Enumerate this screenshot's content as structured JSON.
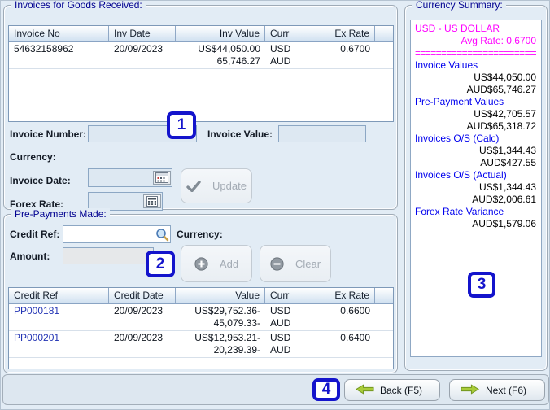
{
  "invoices": {
    "title": "Invoices for Goods Received:",
    "table": {
      "columns": [
        "Invoice No",
        "Inv Date",
        "Inv Value",
        "Curr",
        "Ex Rate"
      ],
      "rows": [
        {
          "invoice_no": "54632158962",
          "inv_date": "20/09/2023",
          "value_line1": "US$44,050.00",
          "value_line2": "65,746.27",
          "curr_line1": "USD",
          "curr_line2": "AUD",
          "ex_rate": "0.6700"
        }
      ]
    },
    "form": {
      "invoice_number_label": "Invoice Number:",
      "invoice_number_value": "",
      "invoice_value_label": "Invoice Value:",
      "invoice_value_value": "",
      "currency_label": "Currency:",
      "invoice_date_label": "Invoice Date:",
      "invoice_date_value": "",
      "forex_rate_label": "Forex Rate:",
      "forex_rate_value": "",
      "update_button_label": "Update"
    }
  },
  "prepayments": {
    "title": "Pre-Payments Made:",
    "form": {
      "credit_ref_label": "Credit Ref:",
      "credit_ref_value": "",
      "currency_label": "Currency:",
      "amount_label": "Amount:",
      "amount_value": "",
      "add_button_label": "Add",
      "clear_button_label": "Clear"
    },
    "table": {
      "columns": [
        "Credit Ref",
        "Credit Date",
        "Value",
        "Curr",
        "Ex Rate"
      ],
      "rows": [
        {
          "credit_ref": "PP000181",
          "credit_date": "20/09/2023",
          "value_line1": "US$29,752.36-",
          "value_line2": "45,079.33-",
          "curr_line1": "USD",
          "curr_line2": "AUD",
          "ex_rate": "0.6600"
        },
        {
          "credit_ref": "PP000201",
          "credit_date": "20/09/2023",
          "value_line1": "US$12,953.21-",
          "value_line2": "20,239.39-",
          "curr_line1": "USD",
          "curr_line2": "AUD",
          "ex_rate": "0.6400"
        }
      ]
    }
  },
  "summary": {
    "title": "Currency Summary:",
    "currency_line": "USD - US DOLLAR",
    "avg_rate_line": "Avg Rate: 0.6700",
    "separator": "=========================",
    "groups": [
      {
        "label": "Invoice Values",
        "values": [
          "US$44,050.00",
          "AUD$65,746.27"
        ]
      },
      {
        "label": "Pre-Payment Values",
        "values": [
          "US$42,705.57",
          "AUD$65,318.72"
        ]
      },
      {
        "label": "Invoices O/S (Calc)",
        "values": [
          "US$1,344.43",
          "AUD$427.55"
        ]
      },
      {
        "label": "Invoices O/S (Actual)",
        "values": [
          "US$1,344.43",
          "AUD$2,006.61"
        ]
      },
      {
        "label": "Forex Rate Variance",
        "values": [
          "AUD$1,579.06"
        ]
      }
    ],
    "colors": {
      "magenta": "#ff00ff",
      "label_blue": "#0000ee"
    }
  },
  "footer": {
    "back_label": "Back (F5)",
    "next_label": "Next (F6)"
  },
  "callouts": [
    "1",
    "2",
    "3",
    "4"
  ]
}
